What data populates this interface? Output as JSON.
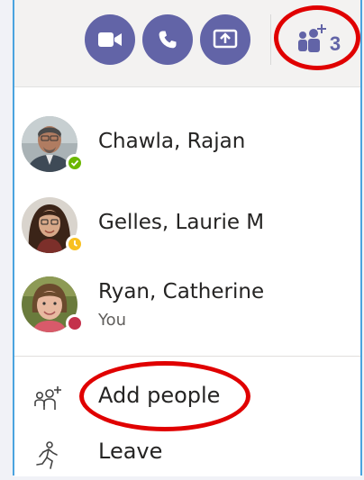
{
  "toolbar": {
    "buttons": [
      {
        "icon": "video-camera-icon"
      },
      {
        "icon": "phone-icon"
      },
      {
        "icon": "share-screen-icon"
      }
    ],
    "participants": {
      "icon": "add-participants-icon",
      "count": "3"
    },
    "accent": "#6264a7"
  },
  "participants": [
    {
      "name": "Chawla, Rajan",
      "status": "available",
      "status_color": "#6bb700"
    },
    {
      "name": "Gelles, Laurie M",
      "status": "away",
      "status_color": "#f8c020"
    },
    {
      "name": "Ryan, Catherine",
      "subtitle": "You",
      "status": "busy",
      "status_color": "#c4314b"
    }
  ],
  "actions": {
    "add_people": {
      "label": "Add people",
      "icon": "add-people-icon"
    },
    "leave": {
      "label": "Leave",
      "icon": "leave-icon"
    }
  },
  "highlight_color": "#e00000"
}
